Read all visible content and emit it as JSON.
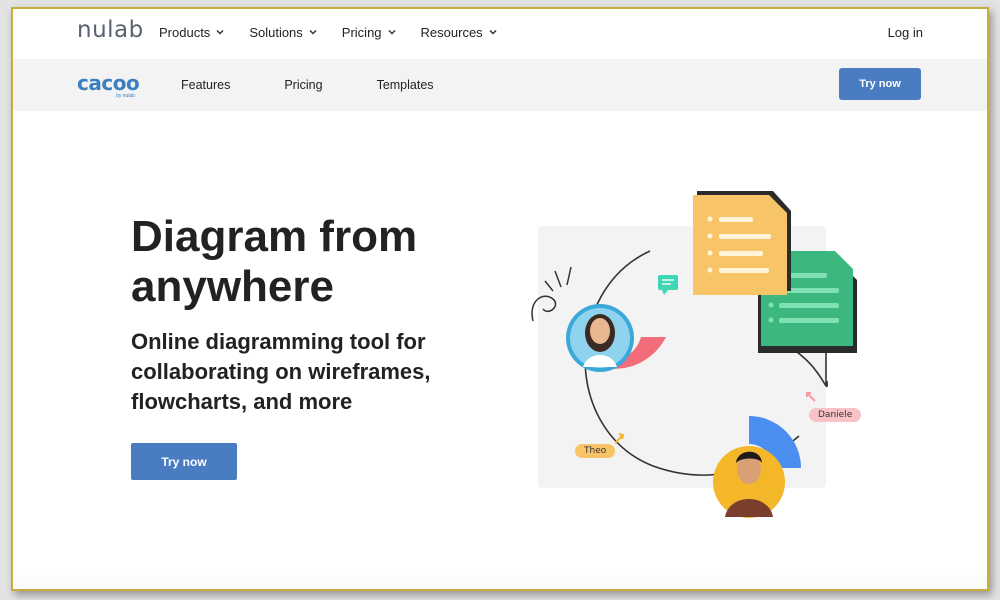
{
  "global_nav": {
    "logo": "nulab",
    "menu": [
      {
        "label": "Products"
      },
      {
        "label": "Solutions"
      },
      {
        "label": "Pricing"
      },
      {
        "label": "Resources"
      }
    ],
    "login": "Log in"
  },
  "product_nav": {
    "logo": "cacoo",
    "logo_by": "by nulab",
    "links": [
      "Features",
      "Pricing",
      "Templates"
    ],
    "cta": "Try now"
  },
  "hero": {
    "title": "Diagram from anywhere",
    "subtitle": "Online diagramming tool for collaborating on wireframes, flowcharts, and more",
    "cta": "Try now"
  },
  "illustration": {
    "tag_theo": "Theo",
    "tag_daniele": "Daniele"
  },
  "colors": {
    "brand_blue": "#4a7cc2",
    "cacoo_blue": "#3a7fc0",
    "doc_yellow": "#f8c468",
    "doc_green": "#3cb87f",
    "accent_red": "#f36c7a",
    "accent_blue": "#4a8ff0",
    "avatar_yellow": "#f5b72a",
    "tag_theo": "#f8c468",
    "tag_daniele": "#f8c2c7"
  }
}
